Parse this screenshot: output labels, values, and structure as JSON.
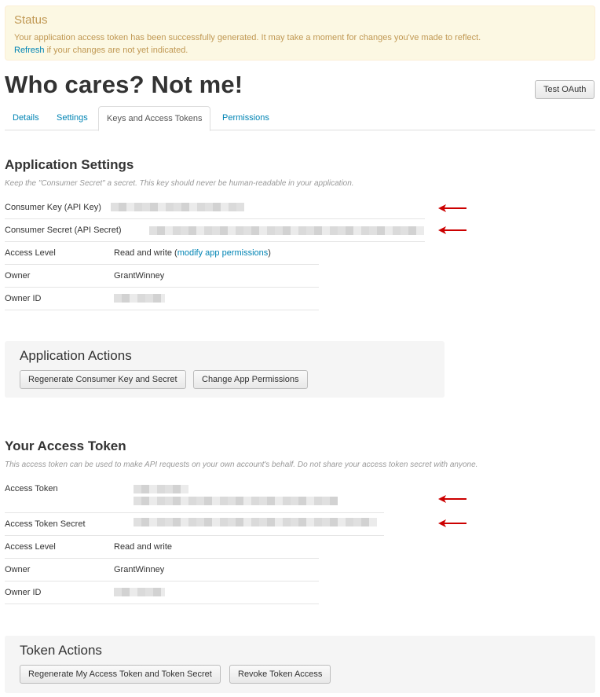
{
  "status": {
    "title": "Status",
    "message": "Your application access token has been successfully generated. It may take a moment for changes you've made to reflect.",
    "refresh_link": "Refresh",
    "refresh_suffix": " if your changes are not yet indicated."
  },
  "page_title": "Who cares? Not me!",
  "test_oauth_label": "Test OAuth",
  "tabs": [
    {
      "label": "Details"
    },
    {
      "label": "Settings"
    },
    {
      "label": "Keys and Access Tokens"
    },
    {
      "label": "Permissions"
    }
  ],
  "app_settings": {
    "heading": "Application Settings",
    "subtitle": "Keep the \"Consumer Secret\" a secret. This key should never be human-readable in your application.",
    "consumer_key_label": "Consumer Key (API Key)",
    "consumer_secret_label": "Consumer Secret (API Secret)",
    "access_level_label": "Access Level",
    "access_level_value": "Read and write (",
    "access_level_link": "modify app permissions",
    "access_level_close": ")",
    "owner_label": "Owner",
    "owner_value": "GrantWinney",
    "owner_id_label": "Owner ID"
  },
  "app_actions": {
    "heading": "Application Actions",
    "regenerate_label": "Regenerate Consumer Key and Secret",
    "change_permissions_label": "Change App Permissions"
  },
  "access_token": {
    "heading": "Your Access Token",
    "subtitle": "This access token can be used to make API requests on your own account's behalf. Do not share your access token secret with anyone.",
    "token_label": "Access Token",
    "secret_label": "Access Token Secret",
    "access_level_label": "Access Level",
    "access_level_value": "Read and write",
    "owner_label": "Owner",
    "owner_value": "GrantWinney",
    "owner_id_label": "Owner ID"
  },
  "token_actions": {
    "heading": "Token Actions",
    "regenerate_label": "Regenerate My Access Token and Token Secret",
    "revoke_label": "Revoke Token Access"
  },
  "colors": {
    "link": "#0084b4",
    "status_bg": "#fcf8e3",
    "status_text": "#c09853",
    "annotation_arrow": "#cc0000"
  }
}
